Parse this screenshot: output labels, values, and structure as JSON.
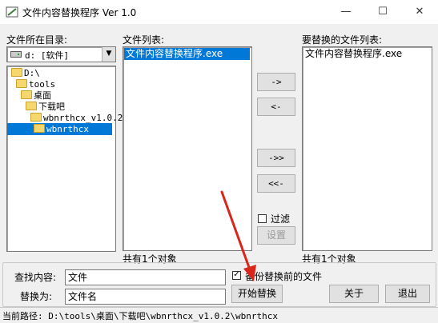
{
  "window": {
    "title": "文件内容替换程序 Ver 1.0",
    "minimize_glyph": "—",
    "maximize_glyph": "☐",
    "close_glyph": "✕"
  },
  "dir_panel": {
    "label": "文件所在目录:",
    "drive": "d: [软件]",
    "tree": [
      "D:\\",
      "tools",
      "桌面",
      "下载吧",
      "wbnrthcx_v1.0.2",
      "wbnrthcx"
    ],
    "selected_index": 5
  },
  "file_list": {
    "label": "文件列表:",
    "items": [
      "文件内容替换程序.exe"
    ],
    "selected_index": 0,
    "count_text": "共有1个对象"
  },
  "replace_list": {
    "label": "要替换的文件列表:",
    "items": [
      "文件内容替换程序.exe"
    ],
    "count_text": "共有1个对象"
  },
  "transfer_buttons": {
    "add": "->",
    "remove": "<-",
    "add_all": "->>",
    "remove_all": "<<-"
  },
  "filter": {
    "label": "过滤",
    "checked": false,
    "settings_label": "设置"
  },
  "form": {
    "find_label": "查找内容:",
    "find_value": "文件",
    "replace_label": "替换为:",
    "replace_value": "文件名"
  },
  "backup": {
    "label": "备份替换前的文件",
    "checked": true
  },
  "actions": {
    "start": "开始替换",
    "about": "关于",
    "exit": "退出"
  },
  "status": {
    "text": "当前路径: D:\\tools\\桌面\\下载吧\\wbnrthcx_v1.0.2\\wbnrthcx"
  },
  "colors": {
    "selection": "#0078d7",
    "annotation_arrow": "#d9261c"
  }
}
